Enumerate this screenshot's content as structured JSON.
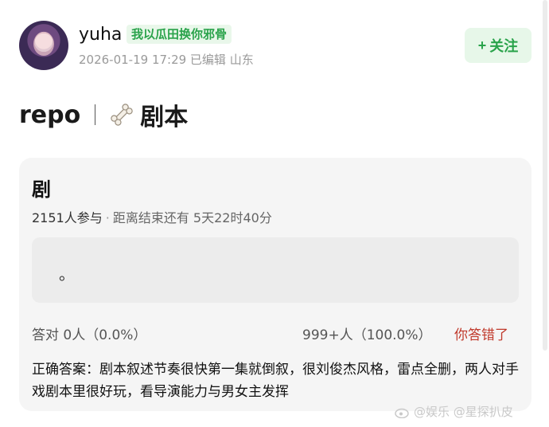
{
  "header": {
    "username": "yuha",
    "badge": "我以瓜田换你邪骨",
    "meta": "2026-01-19 17:29  已编辑  山东",
    "follow_label": "关注"
  },
  "post": {
    "title": "repo",
    "subtitle": "剧本"
  },
  "poll": {
    "title": "剧",
    "participants": "2151人参与",
    "remaining": "距离结束还有 5天22时40分",
    "option_text": "。",
    "correct_label": "答对  0人（0.0%）",
    "others_label": "999+人（100.0%）",
    "wrong_label": "你答错了",
    "answer": "正确答案：剧本叙述节奏很快第一集就倒叙，很刘俊杰风格，雷点全删，两人对手戏剧本里很好玩，看导演能力与男女主发挥"
  },
  "watermark": "@娱乐  @星探扒皮",
  "colors": {
    "accent_green": "#2aa34b",
    "wrong_red": "#c0392b",
    "card_bg": "#f5f5f5"
  }
}
